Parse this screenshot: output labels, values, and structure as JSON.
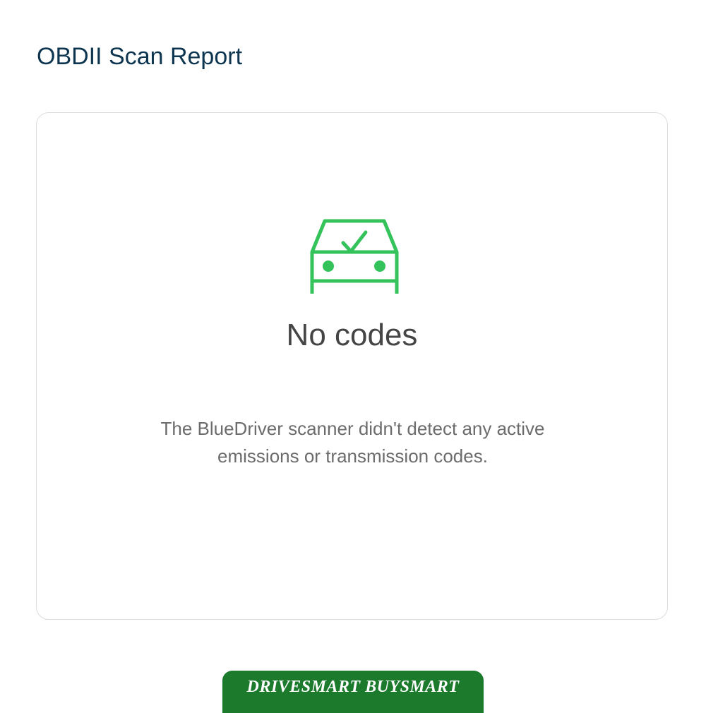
{
  "header": {
    "title": "OBDII Scan Report"
  },
  "report": {
    "status_title": "No codes",
    "status_message": "The BlueDriver scanner didn't detect any active emissions or transmission codes.",
    "icon": "car-check-icon",
    "accent_color": "#34c25a"
  },
  "footer": {
    "banner_text": "DRIVESMART BUYSMART",
    "banner_color": "#1b7a2c"
  }
}
